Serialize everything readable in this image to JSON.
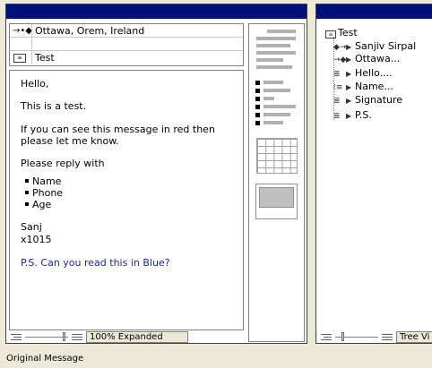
{
  "message_view": {
    "header": {
      "recipients": "Ottawa, Orem, Ireland",
      "subject": "Test"
    },
    "body": {
      "greeting": "Hello,",
      "line1": "This is a test.",
      "line2a": "If you can see this message in red then",
      "line2b": "please let  me know.",
      "line3": "Please reply with",
      "bullets": [
        "Name",
        "Phone",
        "Age"
      ],
      "signature_name": "Sanj",
      "signature_ext": "x1015",
      "ps": "P.S. Can you read this in Blue?"
    },
    "status": {
      "zoom_text": "100% Expanded"
    }
  },
  "tree_view": {
    "root": "Test",
    "nodes": [
      "Sanjiv Sirpal",
      "Ottawa...",
      "Hello....",
      "Name...",
      "Signature",
      "P.S."
    ],
    "status_text": "Tree Vi"
  },
  "caption": "Original Message",
  "colors": {
    "titlebar": "#00107a",
    "ps_text": "#1a2a8a"
  }
}
